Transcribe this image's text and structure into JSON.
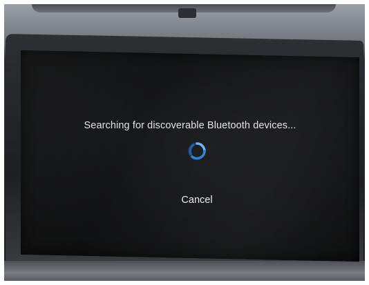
{
  "dialog": {
    "message": "Searching for discoverable Bluetooth devices...",
    "cancel_label": "Cancel",
    "spinner_icon": "loading-spinner-icon"
  },
  "colors": {
    "spinner": "#3a8de0",
    "text": "#e4e4e4",
    "screen_background": "#121314"
  }
}
